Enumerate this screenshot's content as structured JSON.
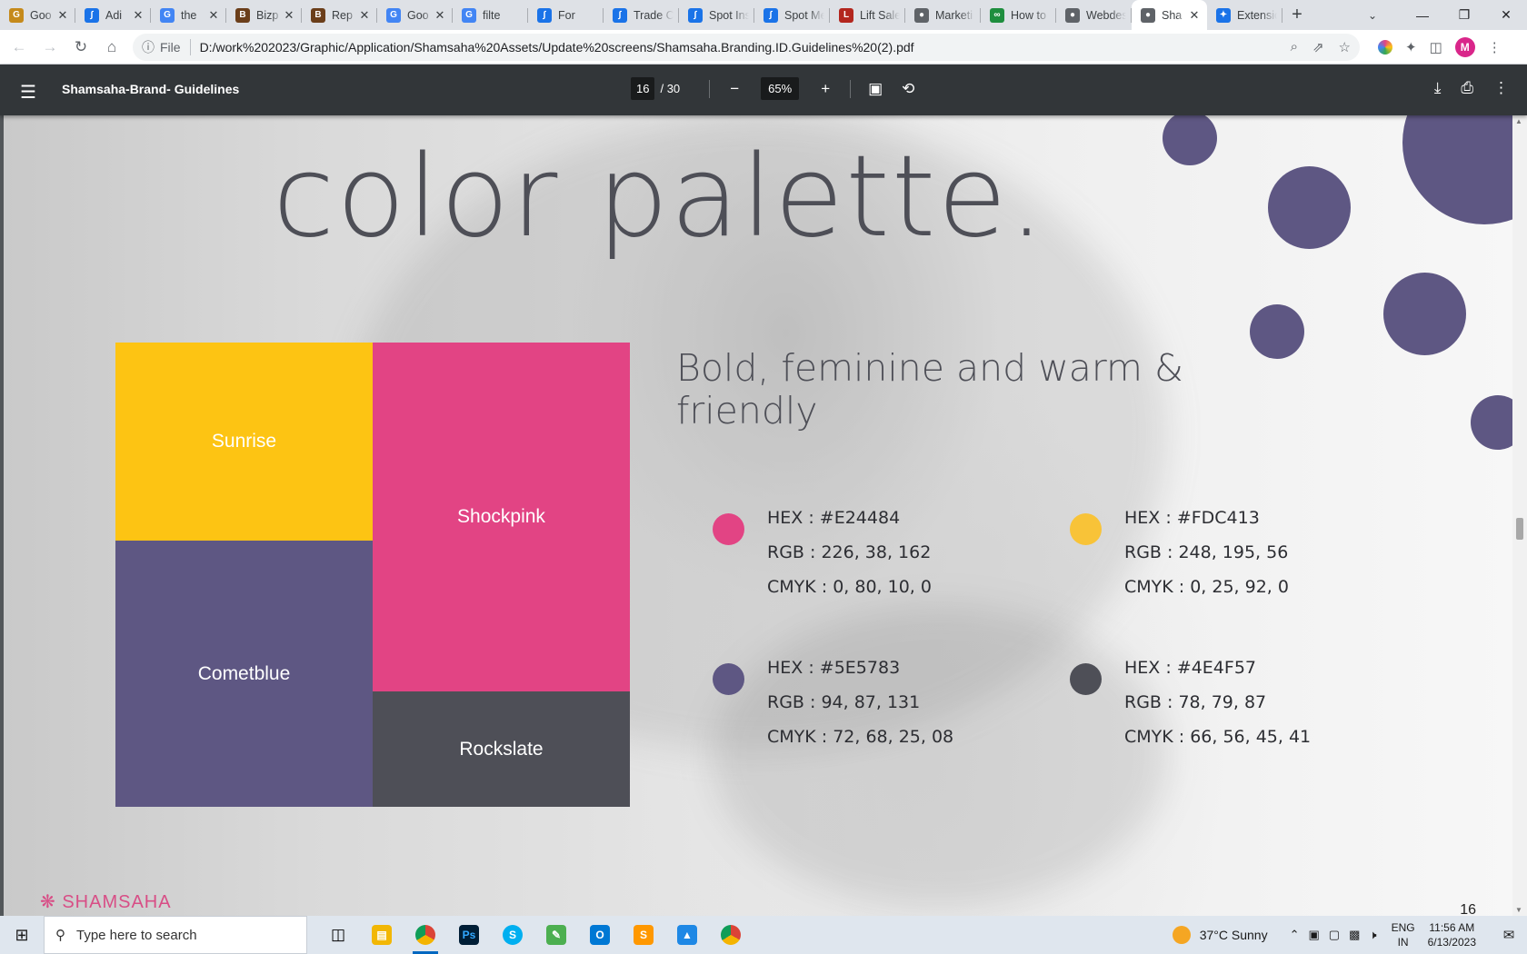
{
  "browser": {
    "tabs": [
      {
        "label": "Goo",
        "icon": "google-icon",
        "color": "#c58a1b",
        "glyph": "G"
      },
      {
        "label": "Adi",
        "icon": "chart-app-icon",
        "color": "#1a73e8",
        "glyph": "∫"
      },
      {
        "label": "the",
        "icon": "google-icon",
        "color": "#4285f4",
        "glyph": "G"
      },
      {
        "label": "Bizp",
        "icon": "book-icon",
        "color": "#6b3e1a",
        "glyph": "B"
      },
      {
        "label": "Rep",
        "icon": "book-icon",
        "color": "#6b3e1a",
        "glyph": "B"
      },
      {
        "label": "Goo",
        "icon": "google-docs-icon",
        "color": "#4285f4",
        "glyph": "G"
      },
      {
        "label": "filte",
        "icon": "google-icon",
        "color": "#4285f4",
        "glyph": "G"
      },
      {
        "label": "For",
        "icon": "chart-app-icon",
        "color": "#1a73e8",
        "glyph": "∫"
      },
      {
        "label": "Trade Cr",
        "icon": "chart-app-icon",
        "color": "#1a73e8",
        "glyph": "∫"
      },
      {
        "label": "Spot Ins",
        "icon": "chart-app-icon",
        "color": "#1a73e8",
        "glyph": "∫"
      },
      {
        "label": "Spot Me",
        "icon": "chart-app-icon",
        "color": "#1a73e8",
        "glyph": "∫"
      },
      {
        "label": "Lift Sale",
        "icon": "lift-icon",
        "color": "#b3261e",
        "glyph": "L"
      },
      {
        "label": "Marketi",
        "icon": "globe-icon",
        "color": "#5f6368",
        "glyph": "●"
      },
      {
        "label": "How to",
        "icon": "link-icon",
        "color": "#1e8e3e",
        "glyph": "∞"
      },
      {
        "label": "Webdes",
        "icon": "globe-icon",
        "color": "#5f6368",
        "glyph": "●"
      },
      {
        "label": "Sha",
        "icon": "globe-icon",
        "color": "#5f6368",
        "glyph": "●",
        "active": true
      },
      {
        "label": "Extensic",
        "icon": "puzzle-icon",
        "color": "#1a73e8",
        "glyph": "✦"
      }
    ],
    "new_tab": "+",
    "address_scheme": "File",
    "url": "D:/work%202023/Graphic/Application/Shamsaha%20Assets/Update%20screens/Shamsaha.Branding.ID.Guidelines%20(2).pdf",
    "avatar_letter": "M"
  },
  "pdf": {
    "title": "Shamsaha-Brand- Guidelines",
    "page_current": "16",
    "page_total": "/ 30",
    "zoom": "65%"
  },
  "page": {
    "heading": "color palette.",
    "tagline_line1": "Bold, feminine and warm &",
    "tagline_line2": "friendly",
    "swatches": [
      {
        "name": "Sunrise",
        "color": "#FDC413"
      },
      {
        "name": "Shockpink",
        "color": "#E24484"
      },
      {
        "name": "Cometblue",
        "color": "#5E5783"
      },
      {
        "name": "Rockslate",
        "color": "#4E4F57"
      }
    ],
    "specs": [
      {
        "hex": "HEX : #E24484",
        "rgb": "RGB : 226, 38, 162",
        "cmyk": "CMYK : 0, 80, 10, 0",
        "color": "#E24484"
      },
      {
        "hex": "HEX : #FDC413",
        "rgb": "RGB : 248, 195, 56",
        "cmyk": "CMYK : 0, 25, 92, 0",
        "color": "#F8C338"
      },
      {
        "hex": "HEX : #5E5783",
        "rgb": "RGB : 94, 87, 131",
        "cmyk": "CMYK : 72, 68, 25, 08",
        "color": "#5E5783"
      },
      {
        "hex": "HEX : #4E4F57",
        "rgb": "RGB : 78, 79, 87",
        "cmyk": "CMYK : 66, 56, 45, 41",
        "color": "#4E4F57"
      }
    ],
    "brand": "SHAMSAHA",
    "page_number": "16"
  },
  "taskbar": {
    "search_placeholder": "Type here to search",
    "weather": "37°C  Sunny",
    "lang_line1": "ENG",
    "lang_line2": "IN",
    "time": "11:56 AM",
    "date": "6/13/2023"
  }
}
